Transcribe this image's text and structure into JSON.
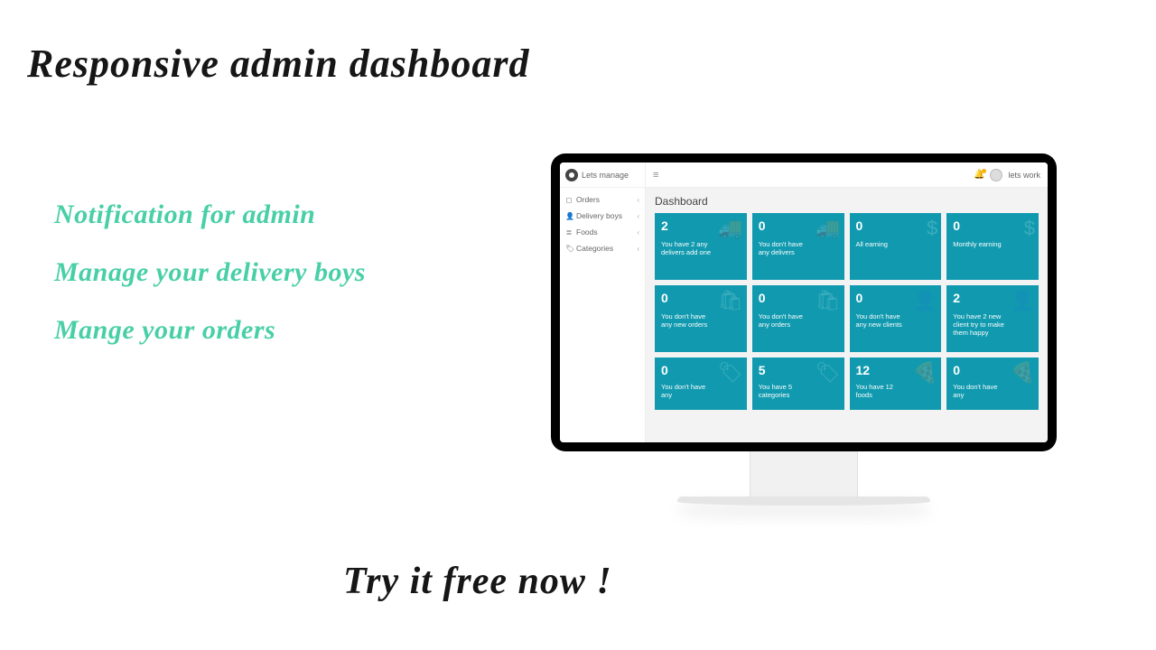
{
  "marketing": {
    "headline": "Responsive admin dashboard",
    "features": [
      "Notification for admin",
      "Manage your delivery boys",
      "Mange your orders"
    ],
    "cta": "Try it free now !"
  },
  "dashboard": {
    "brand": "Lets manage",
    "user_name": "lets work",
    "sidebar": [
      {
        "icon": "◻",
        "label": "Orders"
      },
      {
        "icon": "👤",
        "label": "Delivery boys"
      },
      {
        "icon": "≣",
        "label": "Foods"
      },
      {
        "icon": "🏷",
        "label": "Categories"
      }
    ],
    "main_title": "Dashboard",
    "cards": [
      {
        "num": "2",
        "text": "You have 2 any delivers add one",
        "icon": "🚚"
      },
      {
        "num": "0",
        "text": "You don't have any delivers",
        "icon": "🚚"
      },
      {
        "num": "0",
        "text": "All earning",
        "icon": "$"
      },
      {
        "num": "0",
        "text": "Monthly earning",
        "icon": "$"
      },
      {
        "num": "0",
        "text": "You don't have any new orders",
        "icon": "🛍"
      },
      {
        "num": "0",
        "text": "You don't have any orders",
        "icon": "🛍"
      },
      {
        "num": "0",
        "text": "You don't have any new clients",
        "icon": "👤"
      },
      {
        "num": "2",
        "text": "You have 2 new client try to make them happy",
        "icon": "👤"
      },
      {
        "num": "0",
        "text": "You don't have any",
        "icon": "🏷"
      },
      {
        "num": "5",
        "text": "You have 5 categories",
        "icon": "🏷"
      },
      {
        "num": "12",
        "text": "You have 12 foods",
        "icon": "🍕"
      },
      {
        "num": "0",
        "text": "You don't have any",
        "icon": "🍕"
      }
    ]
  }
}
